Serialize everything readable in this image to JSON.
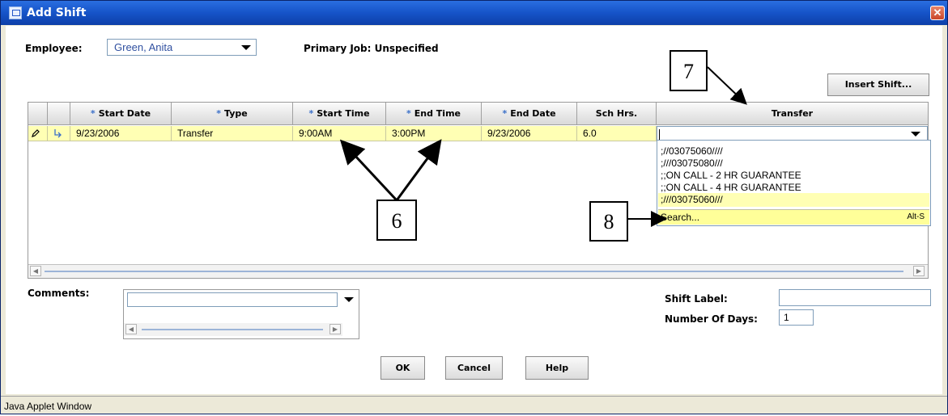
{
  "window": {
    "title": "Add Shift",
    "close_glyph": "✕"
  },
  "employee": {
    "label": "Employee:",
    "value": "Green, Anita"
  },
  "primary_job": "Primary Job: Unspecified",
  "insert_shift_button": "Insert Shift...",
  "table": {
    "columns": [
      "Start Date",
      "Type",
      "Start Time",
      "End Time",
      "End Date",
      "Sch Hrs.",
      "Transfer"
    ],
    "required_marker": "*",
    "rows": [
      {
        "start_date": "9/23/2006",
        "type": "Transfer",
        "start_time": "9:00AM",
        "end_time": "3:00PM",
        "end_date": "9/23/2006",
        "sch_hrs": "6.0",
        "transfer": ""
      }
    ]
  },
  "transfer_dropdown": {
    "options": [
      ";//03075060////",
      ";///03075080///",
      ";;ON CALL - 2 HR GUARANTEE",
      ";;ON CALL - 4 HR GUARANTEE",
      ";///03075060///"
    ],
    "selected_index": 4,
    "search_label": "Search...",
    "search_shortcut": "Alt-S"
  },
  "annotations": [
    "6",
    "7",
    "8"
  ],
  "comments": {
    "label": "Comments:",
    "value": ""
  },
  "shift_label": {
    "label": "Shift Label:",
    "value": ""
  },
  "number_of_days": {
    "label": "Number Of Days:",
    "value": "1"
  },
  "buttons": {
    "ok": "OK",
    "cancel": "Cancel",
    "help": "Help"
  },
  "status_bar": "Java Applet Window",
  "colors": {
    "title_bar": "#1653c8",
    "row_highlight": "#ffffb4",
    "close_button": "#c9462a"
  },
  "icons": [
    "window-icon",
    "close-icon",
    "edit-pencil-icon",
    "row-arrow-icon",
    "dropdown-arrow-icon",
    "scroll-left-icon",
    "scroll-right-icon"
  ]
}
